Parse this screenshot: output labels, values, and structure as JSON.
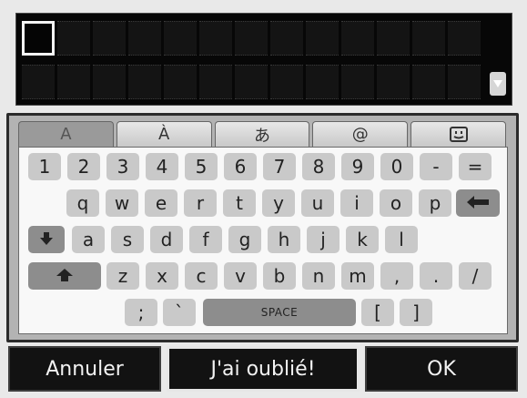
{
  "tabs": [
    {
      "label": "A",
      "selected": true
    },
    {
      "label": "À",
      "selected": false
    },
    {
      "label": "あ",
      "selected": false
    },
    {
      "label": "@",
      "selected": false
    },
    {
      "icon": "smiley-icon",
      "selected": false
    }
  ],
  "keys": {
    "row1": [
      "1",
      "2",
      "3",
      "4",
      "5",
      "6",
      "7",
      "8",
      "9",
      "0",
      "-",
      "="
    ],
    "row2": [
      "q",
      "w",
      "e",
      "r",
      "t",
      "y",
      "u",
      "i",
      "o",
      "p"
    ],
    "row3": [
      "a",
      "s",
      "d",
      "f",
      "g",
      "h",
      "j",
      "k",
      "l"
    ],
    "row4": [
      "z",
      "x",
      "c",
      "v",
      "b",
      "n",
      "m",
      ",",
      ".",
      "/"
    ],
    "row5": [
      ";",
      "`",
      "SPACE",
      "[",
      "]"
    ]
  },
  "buttons": {
    "cancel": "Annuler",
    "forgot": "J'ai oublié!",
    "ok": "OK"
  },
  "colors": {
    "entry_bg": "#070707",
    "key": "#c9c9c9",
    "key_dark": "#8d8d8d",
    "panel": "#b3b3b3"
  }
}
